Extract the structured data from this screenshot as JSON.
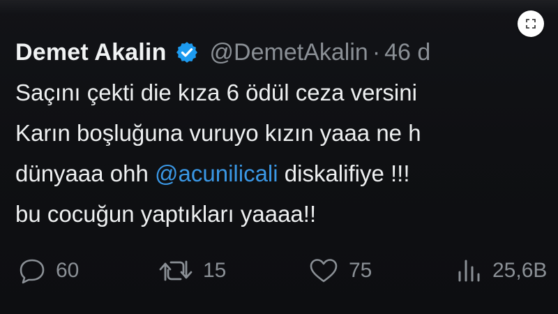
{
  "tweet": {
    "display_name": "Demet Akalin",
    "handle": "@DemetAkalin",
    "separator": "·",
    "time": "46 d",
    "lines": [
      {
        "pre": "Saçını çekti die kıza 6 ödül ceza versini",
        "mention": "",
        "post": ""
      },
      {
        "pre": "Karın boşluğuna vuruyo kızın yaaa ne h",
        "mention": "",
        "post": ""
      },
      {
        "pre": "dünyaaa ohh ",
        "mention": "@acunilicali",
        "post": " diskalifiye !!!"
      },
      {
        "pre": "bu cocuğun yaptıkları yaaaa!!",
        "mention": "",
        "post": ""
      }
    ]
  },
  "actions": {
    "reply": {
      "icon": "reply-icon",
      "count": "60"
    },
    "retweet": {
      "icon": "retweet-icon",
      "count": "15"
    },
    "like": {
      "icon": "heart-icon",
      "count": "75"
    },
    "views": {
      "icon": "views-icon",
      "count": "25,6B"
    }
  },
  "colors": {
    "background": "#0f1013",
    "text": "#e7e9ea",
    "muted": "#8b9096",
    "mention": "#3a97e4",
    "verified": "#1d9bf0"
  }
}
